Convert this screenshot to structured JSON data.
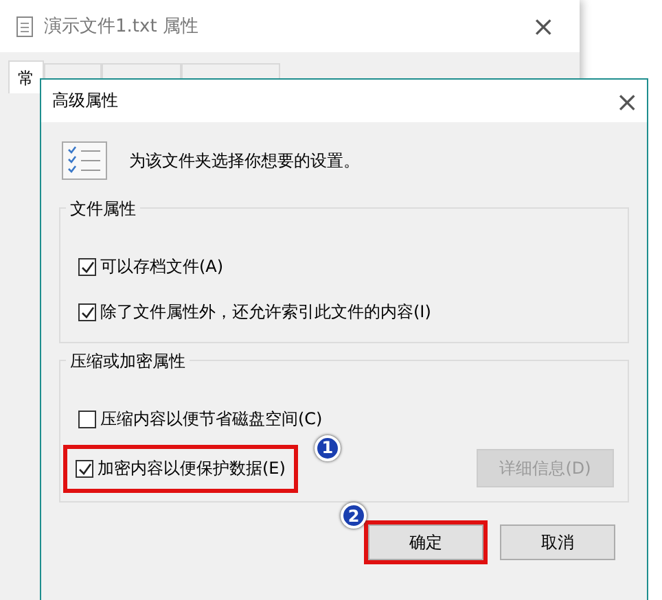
{
  "background_window": {
    "title": "演示文件1.txt 属性",
    "close": "×",
    "tabs": [
      {
        "label": "常",
        "selected": true
      },
      {
        "selected": false
      },
      {
        "selected": false
      },
      {
        "selected": false
      }
    ]
  },
  "dialog": {
    "title": "高级属性",
    "close": "×",
    "description": "为该文件夹选择你想要的设置。",
    "groups": [
      {
        "title": "文件属性",
        "items": [
          {
            "label": "可以存档文件(A)",
            "checked": true
          },
          {
            "label": "除了文件属性外，还允许索引此文件的内容(I)",
            "checked": true
          }
        ]
      },
      {
        "title": "压缩或加密属性",
        "items": [
          {
            "label": "压缩内容以便节省磁盘空间(C)",
            "checked": false
          },
          {
            "label": "加密内容以便保护数据(E)",
            "checked": true,
            "marker": "1"
          }
        ],
        "button": {
          "label": "详细信息(D)",
          "disabled": true
        }
      }
    ],
    "buttons": [
      {
        "label": "确定",
        "marker": "2"
      },
      {
        "label": "取消"
      }
    ]
  }
}
